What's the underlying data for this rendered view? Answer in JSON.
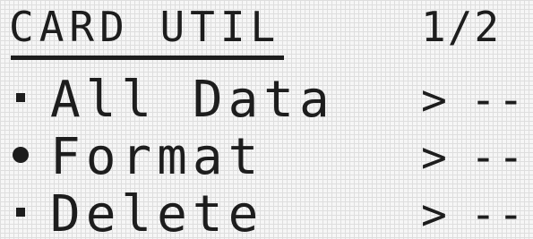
{
  "header": {
    "title": "CARD UTIL",
    "page_indicator": "1/2"
  },
  "menu": {
    "items": [
      {
        "label": "All Data",
        "arrow": ">",
        "value": "--",
        "selected": false
      },
      {
        "label": "Format",
        "arrow": ">",
        "value": "--",
        "selected": true
      },
      {
        "label": "Delete",
        "arrow": ">",
        "value": "--",
        "selected": false
      }
    ]
  },
  "colors": {
    "lcd_background": "#f6f6f6",
    "pixel_grid": "#dedede",
    "lcd_text": "#1d1d1d"
  }
}
